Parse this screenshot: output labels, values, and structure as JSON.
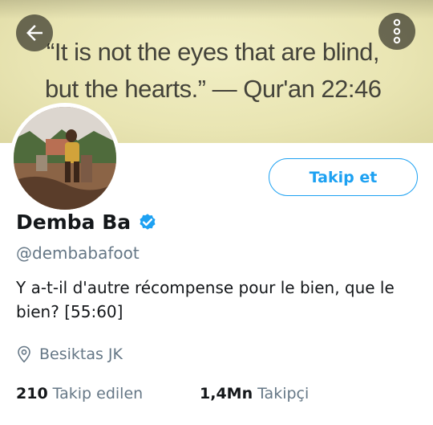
{
  "banner": {
    "quote_line1": "“It is not the eyes that are blind,",
    "quote_line2": "but the hearts.” — Qur'an 22:46",
    "back_icon": "arrow-left-icon",
    "more_icon": "more-vertical-icon"
  },
  "profile": {
    "name": "Demba Ba",
    "handle": "@dembabafoot",
    "verified_icon": "verified-badge-icon",
    "follow_label": "Takip et",
    "bio": "Y a-t-il d'autre récompense pour le bien, que le bien? [55:60]",
    "location": "Besiktas JK",
    "location_icon": "location-pin-icon"
  },
  "stats": {
    "following_count": "210",
    "following_label": "Takip edilen",
    "followers_count": "1,4Mn",
    "followers_label": "Takipçi"
  },
  "colors": {
    "accent": "#1da1f2",
    "text_primary": "#14171a",
    "text_secondary": "#657786"
  }
}
